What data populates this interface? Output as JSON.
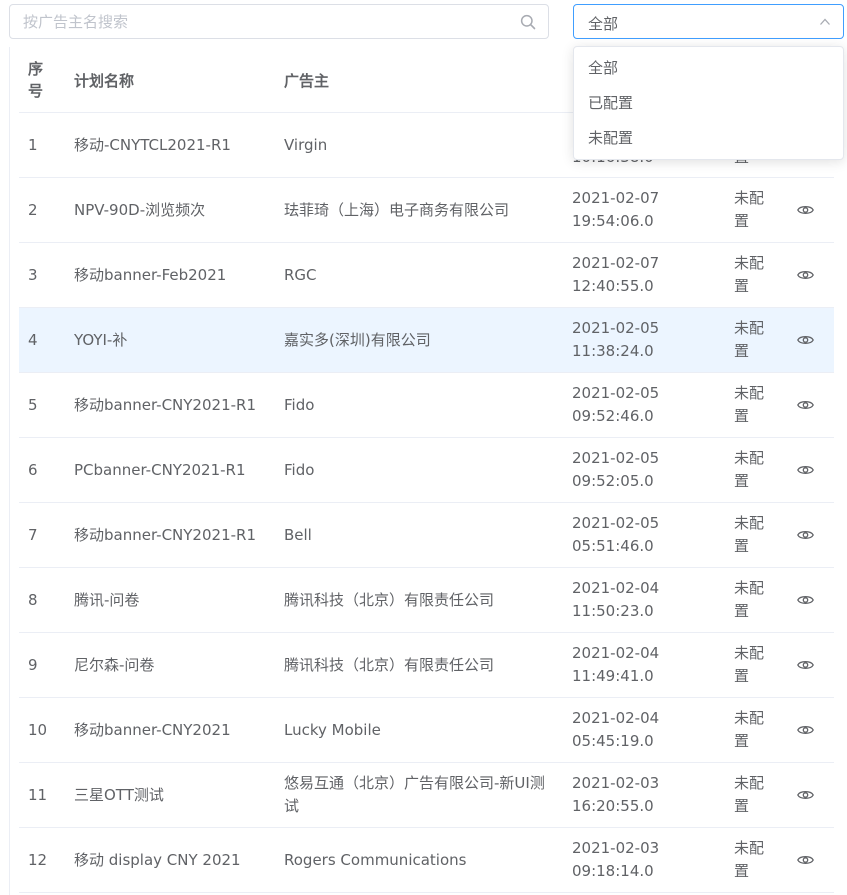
{
  "search": {
    "placeholder": "按广告主名搜索"
  },
  "filter": {
    "selected": "全部",
    "options": [
      "全部",
      "已配置",
      "未配置"
    ]
  },
  "table": {
    "headers": {
      "index": "序号",
      "name": "计划名称",
      "advertiser": "广告主",
      "time": "",
      "status": ""
    },
    "first_row_time_partial": "10:16:38.0",
    "first_row_status_partial": "置",
    "rows": [
      {
        "index": "1",
        "name": "移动-CNYTCL2021-R1",
        "advertiser": "Virgin",
        "time": "",
        "status": ""
      },
      {
        "index": "2",
        "name": "NPV-90D-浏览频次",
        "advertiser": "珐菲琦（上海）电子商务有限公司",
        "time": "2021-02-07 19:54:06.0",
        "status": "未配置"
      },
      {
        "index": "3",
        "name": "移动banner-Feb2021",
        "advertiser": "RGC",
        "time": "2021-02-07 12:40:55.0",
        "status": "未配置"
      },
      {
        "index": "4",
        "name": "YOYI-补",
        "advertiser": "嘉实多(深圳)有限公司",
        "time": "2021-02-05 11:38:24.0",
        "status": "未配置"
      },
      {
        "index": "5",
        "name": "移动banner-CNY2021-R1",
        "advertiser": "Fido",
        "time": "2021-02-05 09:52:46.0",
        "status": "未配置"
      },
      {
        "index": "6",
        "name": "PCbanner-CNY2021-R1",
        "advertiser": "Fido",
        "time": "2021-02-05 09:52:05.0",
        "status": "未配置"
      },
      {
        "index": "7",
        "name": "移动banner-CNY2021-R1",
        "advertiser": "Bell",
        "time": "2021-02-05 05:51:46.0",
        "status": "未配置"
      },
      {
        "index": "8",
        "name": "腾讯-问卷",
        "advertiser": "腾讯科技（北京）有限责任公司",
        "time": "2021-02-04 11:50:23.0",
        "status": "未配置"
      },
      {
        "index": "9",
        "name": "尼尔森-问卷",
        "advertiser": "腾讯科技（北京）有限责任公司",
        "time": "2021-02-04 11:49:41.0",
        "status": "未配置"
      },
      {
        "index": "10",
        "name": "移动banner-CNY2021",
        "advertiser": "Lucky Mobile",
        "time": "2021-02-04 05:45:19.0",
        "status": "未配置"
      },
      {
        "index": "11",
        "name": "三星OTT测试",
        "advertiser": "悠易互通（北京）广告有限公司-新UI测试",
        "time": "2021-02-03 16:20:55.0",
        "status": "未配置"
      },
      {
        "index": "12",
        "name": "移动 display CNY 2021",
        "advertiser": "Rogers Communications",
        "time": "2021-02-03 09:18:14.0",
        "status": "未配置"
      }
    ],
    "highlighted_index": "4"
  },
  "colors": {
    "accent": "#409eff",
    "highlight_row": "#ecf5ff",
    "border": "#ebeef5",
    "text": "#606266"
  },
  "icons": {
    "search": "search-icon",
    "chevron": "chevron-up-icon",
    "action": "eye-icon"
  }
}
